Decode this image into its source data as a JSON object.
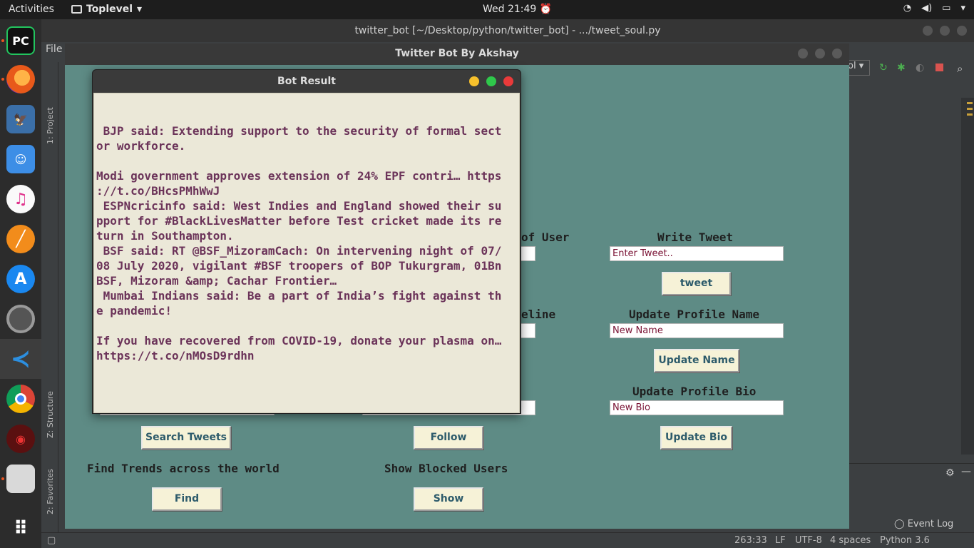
{
  "topbar": {
    "activities": "Activities",
    "app_name": "Toplevel",
    "clock": "Wed 21:49"
  },
  "ide": {
    "title": "twitter_bot [~/Desktop/python/twitter_bot] - .../tweet_soul.py",
    "menu_file": "File",
    "side_labels": {
      "project": "1: Project",
      "structure": "Z: Structure",
      "favorites": "2: Favorites"
    },
    "run_config": "ol",
    "event_log": "Event Log",
    "status": {
      "position": "263:33",
      "line_sep": "LF",
      "encoding": "UTF-8",
      "indent": "4 spaces",
      "interpreter": "Python 3.6"
    }
  },
  "bot_window": {
    "title": "Twitter Bot By Akshay",
    "labels": {
      "of_user": "of User",
      "eline": "eline",
      "write_tweet": "Write Tweet",
      "update_profile_name": "Update Profile Name",
      "update_profile_bio": "Update Profile Bio",
      "find_trends": "Find Trends across the world",
      "show_blocked": "Show Blocked Users"
    },
    "inputs": {
      "tweet": "Enter Tweet..",
      "name": "New Name",
      "bio": "New Bio"
    },
    "buttons": {
      "tweet": "tweet",
      "update_name": "Update Name",
      "update_bio": "Update Bio",
      "search_tweets": "Search Tweets",
      "follow": "Follow",
      "find": "Find",
      "show": "Show"
    }
  },
  "popup": {
    "title": "Bot Result",
    "lines": [
      "",
      " BJP said: Extending support to the security of formal sect",
      "or workforce.",
      "",
      "Modi government approves extension of 24% EPF contri… https",
      "://t.co/BHcsPMhWwJ",
      " ESPNcricinfo said: West Indies and England showed their su",
      "pport for #BlackLivesMatter before Test cricket made its re",
      "turn in Southampton.",
      " BSF said: RT @BSF_MizoramCach: On intervening night of 07/",
      "08 July 2020, vigilant #BSF troopers of BOP Tukurgram, 01Bn",
      "BSF, Mizoram &amp; Cachar Frontier…",
      " Mumbai Indians said: Be a part of India’s fight against th",
      "e pandemic!",
      "",
      "If you have recovered from COVID-19, donate your plasma on…",
      "https://t.co/nMOsD9rdhn"
    ]
  }
}
